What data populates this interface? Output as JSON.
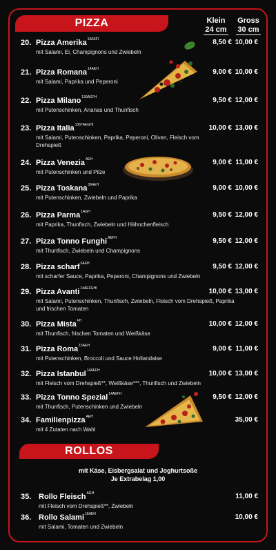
{
  "header": {
    "title": "PIZZA",
    "col_small": "Klein",
    "col_small_size": "24 cm",
    "col_large": "Gross",
    "col_large_size": "30 cm"
  },
  "pizzas": [
    {
      "num": "20.",
      "name": "Pizza Amerika",
      "codes": "16AEFI",
      "desc": "mit Salami, Ei, Champignons und Zwiebeln",
      "price_small": "8,50 €",
      "price_large": "10,00 €"
    },
    {
      "num": "21.",
      "name": "Pizza Romana",
      "codes": "14AEH",
      "desc": "mit Salami, Paprika und Peperoni",
      "price_small": "9,00 €",
      "price_large": "10,00 €"
    },
    {
      "num": "22.",
      "name": "Pizza Milano",
      "codes": "139AEFH",
      "desc": "mit Putenschinken, Ananas und Thunfisch",
      "price_small": "9,50 €",
      "price_large": "12,00 €"
    },
    {
      "num": "23.",
      "name": "Pizza Italia",
      "codes": "1367AEGHI",
      "desc": "mit Salami, Putenschinken, Paprika, Peperoni, Oliven, Fleisch vom Drehspieß",
      "price_small": "10,00 €",
      "price_large": "13,00 €"
    },
    {
      "num": "24.",
      "name": "Pizza Venezia",
      "codes": "AEH",
      "desc": "mit Putenschinken und Pilze",
      "price_small": "9,00 €",
      "price_large": "11,00 €"
    },
    {
      "num": "25.",
      "name": "Pizza Toskana",
      "codes": "36AEH",
      "desc": "mit Putenschinken, Zwiebeln und Paprika",
      "price_small": "9,00 €",
      "price_large": "10,00 €"
    },
    {
      "num": "26.",
      "name": "Pizza Parma",
      "codes": "1AGH",
      "desc": "mit Paprika, Thunfisch, Zwiebeln und Hähnchenfleisch",
      "price_small": "9,50 €",
      "price_large": "12,00 €"
    },
    {
      "num": "27.",
      "name": "Pizza Tonno Funghi",
      "codes": "AEFH",
      "desc": "mit Thunfisch, Zwiebeln und Champignons",
      "price_small": "9,50 €",
      "price_large": "12,00 €"
    },
    {
      "num": "28.",
      "name": "Pizza scharf",
      "codes": "6AEH",
      "desc": "mit scharfer Sauce, Paprika, Peperoni, Champignons und Zwiebeln",
      "price_small": "9,50 €",
      "price_large": "12,00 €"
    },
    {
      "num": "29.",
      "name": "Pizza Avanti",
      "codes": "14AEFGHI",
      "desc": "mit Salami, Putenschinken, Thunfisch, Zwiebeln, Fleisch vom Drehspieß, Paprika und frischen Tomaten",
      "price_small": "10,00 €",
      "price_large": "13,00 €"
    },
    {
      "num": "30.",
      "name": "Pizza Mista",
      "codes": "FH",
      "desc": "mit Thunfisch, frischen Tomaten und Weißkäse",
      "price_small": "10,00 €",
      "price_large": "12,00 €"
    },
    {
      "num": "31.",
      "name": "Pizza Roma",
      "codes": "15AEH",
      "desc": "mit Putenschinken, Broccoli und Sauce Hollandaise",
      "price_small": "9,00 €",
      "price_large": "11,00 €"
    },
    {
      "num": "32.",
      "name": "Pizza Istanbul",
      "codes": "14AEFH",
      "desc": "mit Fleisch vom Drehspieß**, Weißkäse***, Thunfisch und Zwiebeln",
      "price_small": "10,00 €",
      "price_large": "13,00 €"
    },
    {
      "num": "33.",
      "name": "Pizza Tonno Spezial",
      "codes": "14AEFH",
      "desc": "mit Thunfisch, Putenschinken und Zwiebeln",
      "price_small": "9,50 €",
      "price_large": "12,00 €"
    },
    {
      "num": "34.",
      "name": "Familienpizza",
      "codes": "AEH",
      "desc": "mit 4 Zutaten nach Wahl",
      "price_small": "",
      "price_large": "35,00 €"
    }
  ],
  "rollos": {
    "title": "ROLLOS",
    "note_line1": "mit Käse, Eisbergsalat und Joghurtsoße",
    "note_line2": "Je Extrabelag 1,00",
    "items": [
      {
        "num": "35.",
        "name": "Rollo Fleisch",
        "codes": "AGH",
        "desc": "mit Fleisch vom Drehspieß**, Zwiebeln",
        "price": "11,00 €"
      },
      {
        "num": "36.",
        "name": "Rollo Salami",
        "codes": "16AEH",
        "desc": "mit Salami, Tomaten und Zwiebeln",
        "price": "10,00 €"
      }
    ]
  },
  "colors": {
    "accent": "#c8151b",
    "background": "#0b0b0b",
    "text": "#ffffff"
  }
}
